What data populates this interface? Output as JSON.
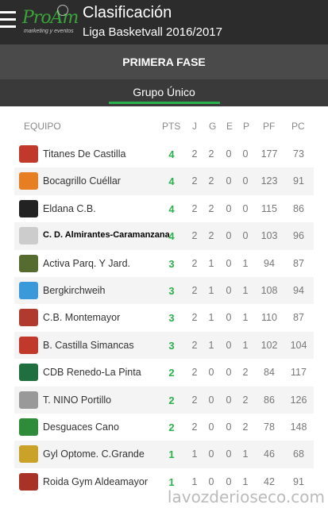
{
  "header": {
    "title": "Clasificación",
    "subtitle": "Liga Basketvall 2016/2017",
    "logo_text": "ProAm",
    "logo_tagline": "marketing y eventos"
  },
  "phase": {
    "label": "PRIMERA FASE"
  },
  "group_tab": {
    "label": "Grupo Único"
  },
  "columns": [
    "EQUIPO",
    "PTS",
    "J",
    "G",
    "E",
    "P",
    "PF",
    "PC"
  ],
  "rows": [
    {
      "team": "Titanes De Castilla",
      "pts": "4",
      "j": "2",
      "g": "2",
      "e": "0",
      "p": "0",
      "pf": "177",
      "pc": "73",
      "logo_color": "#c0392b"
    },
    {
      "team": "Bocagrillo Cuéllar",
      "pts": "4",
      "j": "2",
      "g": "2",
      "e": "0",
      "p": "0",
      "pf": "123",
      "pc": "91",
      "logo_color": "#e67e22"
    },
    {
      "team": "Eldana C.B.",
      "pts": "4",
      "j": "2",
      "g": "2",
      "e": "0",
      "p": "0",
      "pf": "115",
      "pc": "86",
      "logo_color": "#222222"
    },
    {
      "team": "C. D. Almirantes-Caramanzana",
      "pts": "4",
      "j": "2",
      "g": "2",
      "e": "0",
      "p": "0",
      "pf": "103",
      "pc": "96",
      "logo_color": "#cccccc"
    },
    {
      "team": "Activa Parq. Y Jard.",
      "pts": "3",
      "j": "2",
      "g": "1",
      "e": "0",
      "p": "1",
      "pf": "94",
      "pc": "87",
      "logo_color": "#556b2f"
    },
    {
      "team": "Bergkirchweih",
      "pts": "3",
      "j": "2",
      "g": "1",
      "e": "0",
      "p": "1",
      "pf": "108",
      "pc": "94",
      "logo_color": "#3a9ad9"
    },
    {
      "team": "C.B. Montemayor",
      "pts": "3",
      "j": "2",
      "g": "1",
      "e": "0",
      "p": "1",
      "pf": "110",
      "pc": "87",
      "logo_color": "#b03a2e"
    },
    {
      "team": "B. Castilla Simancas",
      "pts": "3",
      "j": "2",
      "g": "1",
      "e": "0",
      "p": "1",
      "pf": "102",
      "pc": "104",
      "logo_color": "#c0392b"
    },
    {
      "team": "CDB Renedo-La Pinta",
      "pts": "2",
      "j": "2",
      "g": "0",
      "e": "0",
      "p": "2",
      "pf": "84",
      "pc": "117",
      "logo_color": "#1f6f3f"
    },
    {
      "team": "T. NINO Portillo",
      "pts": "2",
      "j": "2",
      "g": "0",
      "e": "0",
      "p": "2",
      "pf": "86",
      "pc": "126",
      "logo_color": "#999999"
    },
    {
      "team": "Desguaces Cano",
      "pts": "2",
      "j": "2",
      "g": "0",
      "e": "0",
      "p": "2",
      "pf": "78",
      "pc": "148",
      "logo_color": "#2e8b3a"
    },
    {
      "team": "Gyl Optome. C.Grande",
      "pts": "1",
      "j": "1",
      "g": "0",
      "e": "0",
      "p": "1",
      "pf": "46",
      "pc": "68",
      "logo_color": "#c9a227"
    },
    {
      "team": "Roida Gym Aldeamayor",
      "pts": "1",
      "j": "1",
      "g": "0",
      "e": "0",
      "p": "1",
      "pf": "42",
      "pc": "91",
      "logo_color": "#a93226"
    }
  ],
  "watermark": "lavozderioseco.com",
  "colors": {
    "accent": "#2bb24c",
    "appbar": "#2c2c2c"
  }
}
